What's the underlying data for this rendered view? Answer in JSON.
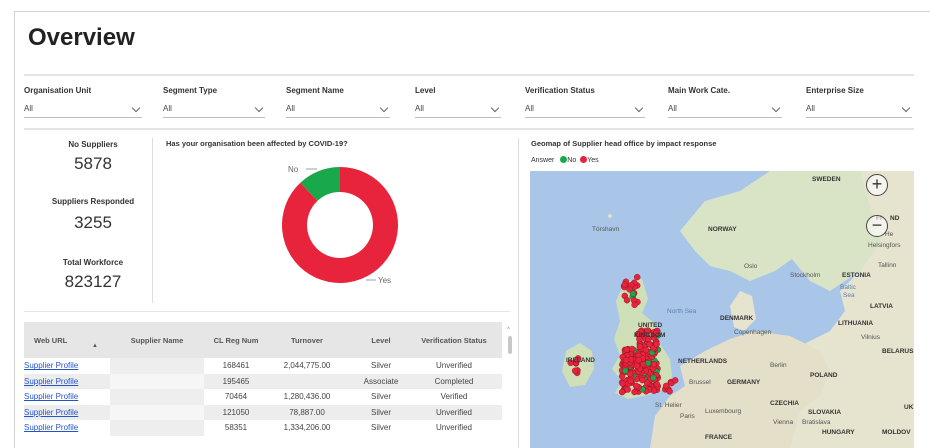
{
  "page": {
    "title": "Overview"
  },
  "filters": [
    {
      "label": "Organisation Unit",
      "value": "All"
    },
    {
      "label": "Segment Type",
      "value": "All"
    },
    {
      "label": "Segment Name",
      "value": "All"
    },
    {
      "label": "Level",
      "value": "All"
    },
    {
      "label": "Verification Status",
      "value": "All"
    },
    {
      "label": "Main Work Cate.",
      "value": "All"
    },
    {
      "label": "Enterprise Size",
      "value": "All"
    }
  ],
  "kpis": [
    {
      "label": "No Suppliers",
      "value": "5878"
    },
    {
      "label": "Suppliers Responded",
      "value": "3255"
    },
    {
      "label": "Total Workforce",
      "value": "823127"
    }
  ],
  "covid_chart": {
    "title": "Has your organisation been affected by COVID-19?",
    "label_no": "No",
    "label_yes": "Yes",
    "color_no": "#19a84a",
    "color_yes": "#e8243c"
  },
  "chart_data": {
    "type": "pie",
    "donut": true,
    "title": "Has your organisation been affected by COVID-19?",
    "categories": [
      "No",
      "Yes"
    ],
    "values": [
      12,
      88
    ],
    "colors": [
      "#19a84a",
      "#e8243c"
    ]
  },
  "table": {
    "headers": [
      "Web URL",
      "Supplier Name",
      "CL Reg Num",
      "Turnover",
      "Level",
      "Verification Status"
    ],
    "rows": [
      {
        "url": "Supplier Profile",
        "name": "",
        "reg": "168461",
        "turnover": "2,044,775.00",
        "level": "Silver",
        "status": "Unverified"
      },
      {
        "url": "Supplier Profile",
        "name": "",
        "reg": "195465",
        "turnover": "",
        "level": "Associate",
        "status": "Completed"
      },
      {
        "url": "Supplier Profile",
        "name": "",
        "reg": "70464",
        "turnover": "1,280,436.00",
        "level": "Silver",
        "status": "Verified"
      },
      {
        "url": "Supplier Profile",
        "name": "",
        "reg": "121050",
        "turnover": "78,887.00",
        "level": "Silver",
        "status": "Unverified"
      },
      {
        "url": "Supplier Profile",
        "name": "",
        "reg": "58351",
        "turnover": "1,334,206.00",
        "level": "Silver",
        "status": "Unverified"
      }
    ]
  },
  "map": {
    "title": "Geomap of Supplier head office by impact response",
    "legend_title": "Answer",
    "legend": [
      {
        "label": "No",
        "color": "#19a84a"
      },
      {
        "label": "Yes",
        "color": "#e8243c"
      }
    ],
    "zoom_in": "+",
    "zoom_out": "−",
    "labels": {
      "sweden": "SWEDEN",
      "fi": "FI",
      "nd": "ND",
      "he": "He",
      "helsingfors": "Helsingfors",
      "torshavn": "Tórshavn",
      "norway": "NORWAY",
      "oslo": "Oslo",
      "stockholm": "Stockholm",
      "tallinn": "Tallinn",
      "estonia": "ESTONIA",
      "baltic": "Baltic",
      "sea": "Sea",
      "latvia": "LATVIA",
      "north_sea": "North Sea",
      "denmark": "DENMARK",
      "lithuania": "LITHUANIA",
      "copenhagen": "Copenhagen",
      "vilnius": "Vilnius",
      "united": "UNITED",
      "kingdom": "KINGDOM",
      "belarus": "BELARUS",
      "ireland": "IRELAND",
      "netherlands": "NETHERLANDS",
      "berlin": "Berlin",
      "poland": "POLAND",
      "germany": "GERMANY",
      "brussel": "Brussel",
      "st_helier": "St. Helier",
      "paris": "Paris",
      "luxembourg": "Luxembourg",
      "czechia": "CZECHIA",
      "slovakia": "SLOVAKIA",
      "vienna": "Vienna",
      "bratislava": "Bratislava",
      "uk": "UK",
      "hungary": "HUNGARY",
      "moldova": "MOLDOV",
      "france": "FRANCE"
    }
  }
}
